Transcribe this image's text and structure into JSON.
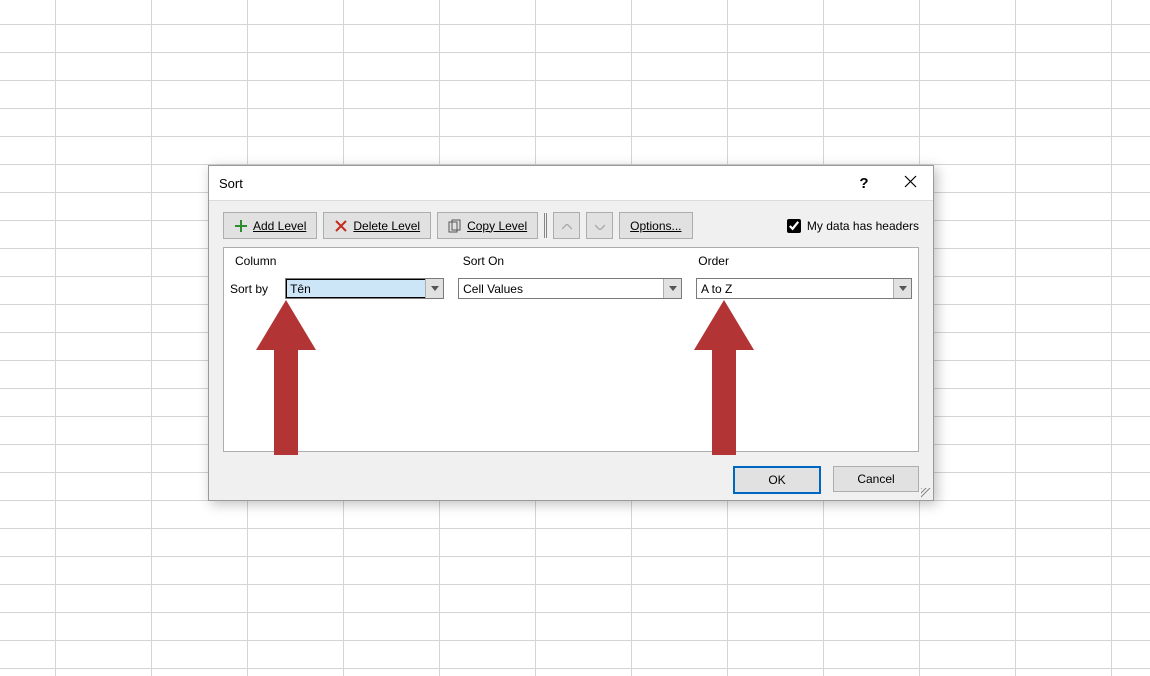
{
  "dialog": {
    "title": "Sort",
    "toolbar": {
      "add_level": "Add Level",
      "delete_level": "Delete Level",
      "copy_level": "Copy Level",
      "options": "Options...",
      "headers_label_prefix": "My data has ",
      "headers_label_under": "h",
      "headers_label_suffix": "eaders"
    },
    "headers": {
      "column": "Column",
      "sort_on": "Sort On",
      "order": "Order"
    },
    "row": {
      "sort_by": "Sort by",
      "column": "Tên",
      "sort_on": "Cell Values",
      "order": "A to Z"
    },
    "footer": {
      "ok": "OK",
      "cancel": "Cancel"
    }
  }
}
